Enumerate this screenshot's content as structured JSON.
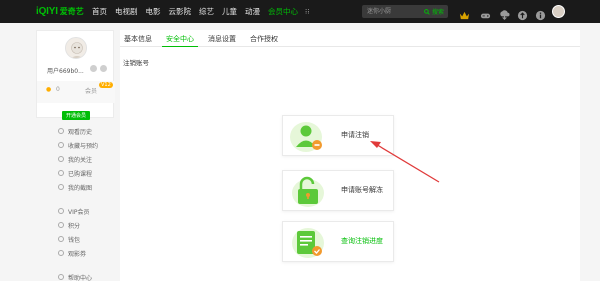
{
  "topbar": {
    "brand_logo": "iQIYI",
    "brand_cn": "爱奇艺",
    "nav": [
      "首页",
      "电视剧",
      "电影",
      "云影院",
      "综艺",
      "儿童",
      "动漫",
      "会员中心"
    ],
    "active_nav_index": 7,
    "more_icon": "grid-dots-icon",
    "search": {
      "placeholder": "迷你小厨",
      "button_label": "搜索"
    },
    "icons": [
      "crown-icon",
      "game-controller-icon",
      "download-icon",
      "upload-icon",
      "info-icon",
      "user-avatar"
    ],
    "accent_color": "#00be06"
  },
  "profile": {
    "username": "用户669b0...",
    "gold_count": "0",
    "vip_label": "会员",
    "vip_tag": "V12",
    "open_vip_button": "开通会员"
  },
  "sidebar": {
    "items": [
      {
        "label": "观看历史",
        "icon": "history-icon"
      },
      {
        "label": "收藏与预约",
        "icon": "star-icon"
      },
      {
        "label": "我的关注",
        "icon": "follow-icon"
      },
      {
        "label": "已购课程",
        "icon": "course-icon"
      },
      {
        "label": "我的截图",
        "icon": "screenshot-icon"
      },
      {
        "label": "VIP会员",
        "icon": "vip-icon"
      },
      {
        "label": "积分",
        "icon": "points-icon"
      },
      {
        "label": "钱包",
        "icon": "wallet-icon"
      },
      {
        "label": "观影券",
        "icon": "ticket-icon"
      },
      {
        "label": "帮助中心",
        "icon": "help-icon"
      }
    ]
  },
  "main": {
    "tabs": [
      "基本信息",
      "安全中心",
      "消息设置",
      "合作授权"
    ],
    "active_tab_index": 1,
    "section_title": "注销账号",
    "options": [
      {
        "label": "申请注销",
        "icon": "user-minus-icon"
      },
      {
        "label": "申请账号解冻",
        "icon": "unlock-icon"
      },
      {
        "label": "查询注销进度",
        "icon": "document-check-icon"
      }
    ]
  },
  "annotation": {
    "arrow_color": "#e03a3a"
  }
}
